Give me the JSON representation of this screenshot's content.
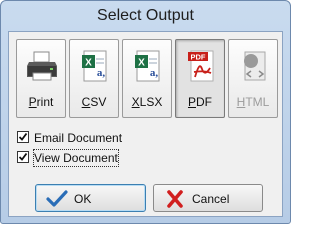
{
  "window": {
    "title": "Select Output"
  },
  "formats": [
    {
      "label_u": "P",
      "label_rest": "rint",
      "icon": "printer-icon"
    },
    {
      "label_u": "C",
      "label_rest": "SV",
      "icon": "excel-csv-icon"
    },
    {
      "label_u": "X",
      "label_rest": "LSX",
      "icon": "excel-xlsx-icon"
    },
    {
      "label_u": "P",
      "label_rest": "DF",
      "icon": "adobe-pdf-icon",
      "selected": true,
      "icon_text": "PDF"
    },
    {
      "label_u": "H",
      "label_rest": "TML",
      "icon": "html-document-icon",
      "disabled": true
    }
  ],
  "options": {
    "email": {
      "label_u": "E",
      "label_rest": "mail Document",
      "checked": true
    },
    "view": {
      "label_u": "V",
      "label_rest": "iew Document",
      "checked": true
    }
  },
  "buttons": {
    "ok": {
      "label": "OK",
      "icon": "checkmark-icon"
    },
    "cancel": {
      "label": "Cancel",
      "icon": "x-mark-icon"
    }
  },
  "colors": {
    "title_bar": "#c9dbef",
    "ok_check": "#2a6db7",
    "cancel_x": "#d11f1f",
    "pdf_red": "#c8201a",
    "excel_green": "#1e7145"
  }
}
